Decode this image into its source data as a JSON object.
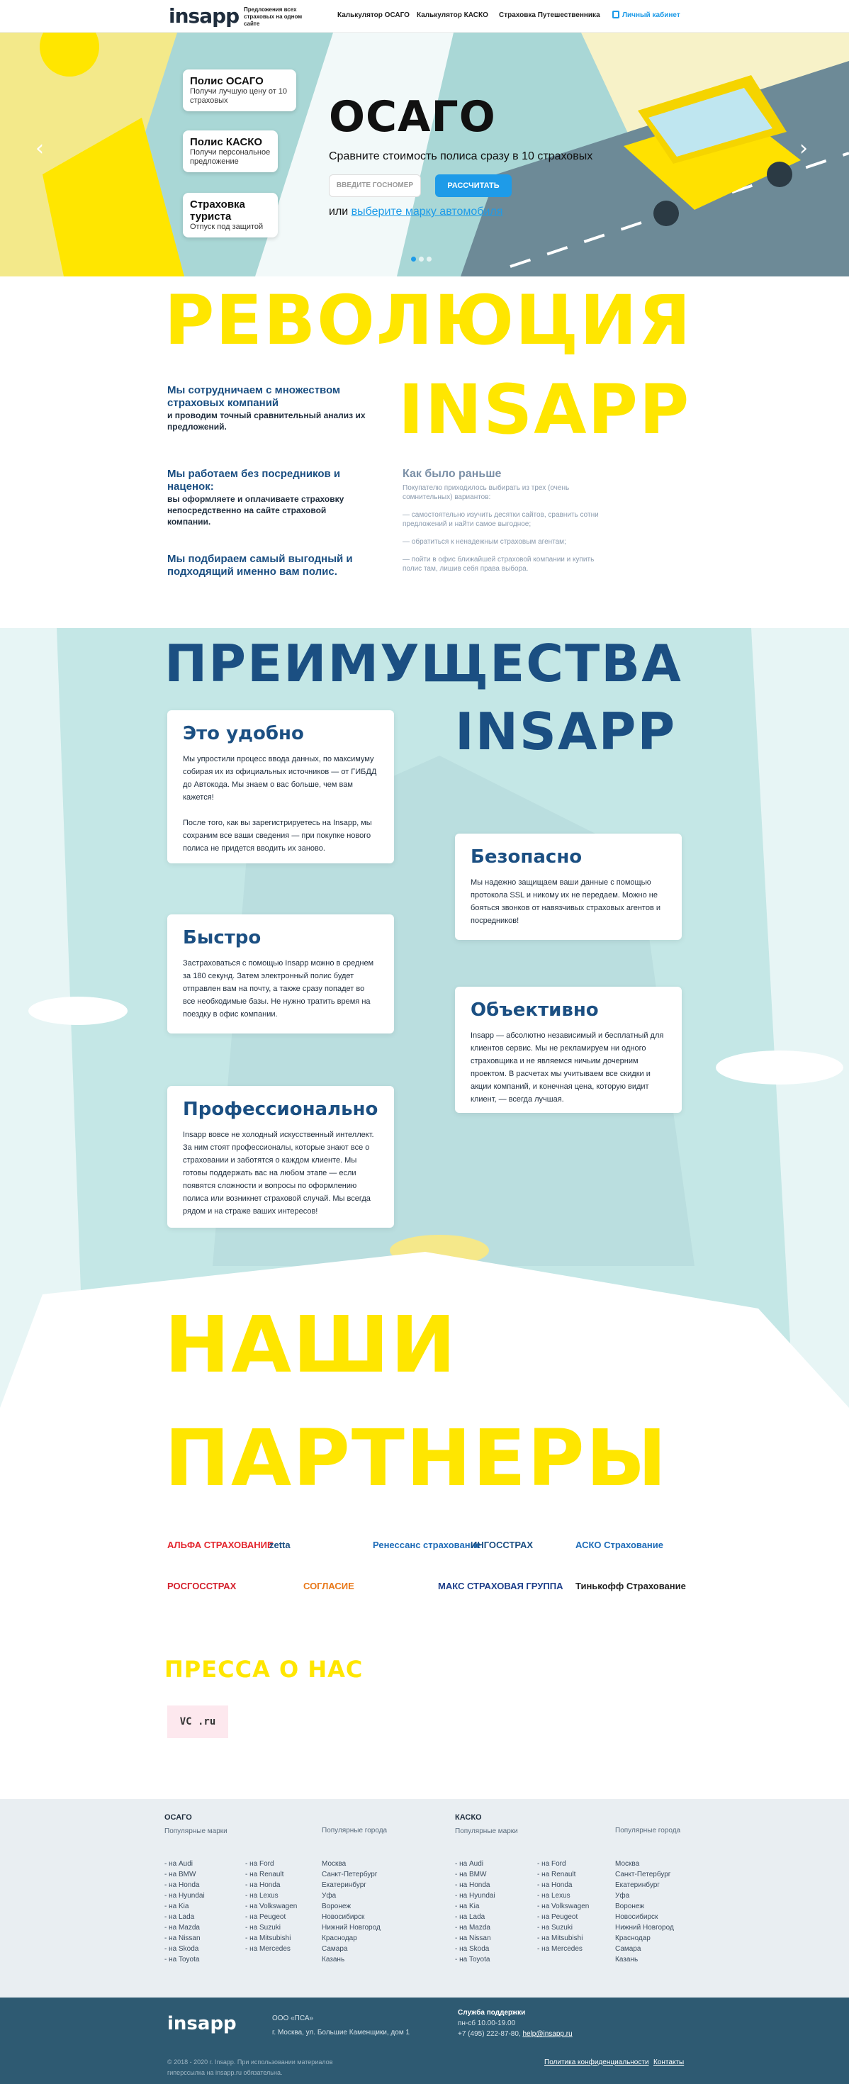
{
  "header": {
    "logo": "insapp",
    "tagline": "Предложения всех страховых на одном сайте",
    "nav": [
      "Калькулятор ОСАГО",
      "Калькулятор КАСКО",
      "Страховка Путешественника"
    ],
    "cabinet": "Личный кабинет"
  },
  "hero": {
    "cards": [
      {
        "title": "Полис ОСАГО",
        "sub": "Получи лучшую цену от 10 страховых"
      },
      {
        "title": "Полис КАСКО",
        "sub": "Получи персональное предложение"
      },
      {
        "title": "Страховка туриста",
        "sub": "Отпуск под защитой"
      }
    ],
    "title": "ОСАГО",
    "subtitle": "Сравните стоимость полиса сразу в 10 страховых",
    "input_placeholder": "ВВЕДИТЕ ГОСНОМЕР",
    "button": "РАССЧИТАТЬ",
    "or": "или",
    "link": "выберите марку автомобиля"
  },
  "revolution": {
    "title1": "РЕВОЛЮЦИЯ",
    "title2": "INSAPP",
    "points": [
      {
        "bold": "Мы сотрудничаем с множеством страховых компаний",
        "text": "и проводим точный сравнительный анализ их предложений."
      },
      {
        "bold": "Мы работаем без посредников и наценок:",
        "text": "вы оформляете и оплачиваете страховку непосредственно на сайте страховой компании."
      },
      {
        "bold": "Мы подбираем самый выгодный и подходящий именно вам полис.",
        "text": ""
      }
    ],
    "was_title": "Как было раньше",
    "was_items": [
      "Покупателю приходилось выбирать из трех (очень сомнительных) вариантов:",
      "— самостоятельно изучить десятки сайтов, сравнить сотни предложений и найти самое выгодное;",
      "— обратиться к ненадежным страховым агентам;",
      "— пойти в офис ближайшей страховой компании и купить полис там, лишив себя права выбора."
    ]
  },
  "advantages": {
    "title1": "ПРЕИМУЩЕСТВА",
    "title2": "INSAPP",
    "cards": [
      {
        "title": "Это удобно",
        "text": "Мы упростили процесс ввода данных, по максимуму собирая их из официальных источников — от ГИБДД до Автокода. Мы знаем о вас больше, чем вам кажется!\n\nПосле того, как вы зарегистрируетесь на Insapp, мы сохраним все ваши сведения — при покупке нового полиса не придется вводить их заново."
      },
      {
        "title": "Безопасно",
        "text": "Мы надежно защищаем ваши данные с помощью протокола SSL и никому их не передаем. Можно не бояться звонков от навязчивых страховых агентов и посредников!"
      },
      {
        "title": "Быстро",
        "text": "Застраховаться с помощью Insapp можно в среднем за 180 секунд. Затем электронный полис будет отправлен вам на почту, а также сразу попадет во все необходимые базы. Не нужно тратить время на поездку в офис компании."
      },
      {
        "title": "Объективно",
        "text": "Insapp — абсолютно независимый и бесплатный для клиентов сервис. Мы не рекламируем ни одного страховщика и не являемся ничьим дочерним проектом. В расчетах мы учитываем все скидки и акции компаний, и конечная цена, которую видит клиент, — всегда лучшая."
      },
      {
        "title": "Профессионально",
        "text": "Insapp вовсе не холодный искусственный интеллект. За ним стоят профессионалы, которые знают все о страховании и заботятся о каждом клиенте. Мы готовы поддержать вас на любом этапе — если появятся сложности и вопросы по оформлению полиса или возникнет страховой случай. Мы всегда рядом и на страже ваших интересов!"
      }
    ]
  },
  "partners": {
    "title1": "НАШИ",
    "title2": "ПАРТНЕРЫ",
    "logos": [
      "АЛЬФА СТРАХОВАНИЕ",
      "zetta",
      "Ренессанс страхование",
      "ИНГОССТРАХ",
      "АСКО Страхование",
      "РОСГОССТРАХ",
      "СОГЛАСИЕ",
      "МАКС СТРАХОВАЯ ГРУППА",
      "Тинькофф Страхование"
    ],
    "colors": [
      "#e3262e",
      "#1b4f82",
      "#1e6cb8",
      "#1b4f82",
      "#1e6cb8",
      "#d4202c",
      "#e8781a",
      "#1e3f8a",
      "#222"
    ]
  },
  "press": {
    "title": "ПРЕССА О НАС",
    "logo": "VC .ru"
  },
  "footer": {
    "osago": {
      "title": "ОСАГО",
      "brands_h": "Популярные марки",
      "cities_h": "Популярные города"
    },
    "kasko": {
      "title": "КАСКО",
      "brands_h": "Популярные марки",
      "cities_h": "Популярные города"
    },
    "brands1": [
      "- на Audi",
      "- на BMW",
      "- на Honda",
      "- на Hyundai",
      "- на Kia",
      "- на Lada",
      "- на Mazda",
      "- на Nissan",
      "- на Skoda",
      "- на Toyota"
    ],
    "brands2": [
      "- на Ford",
      "- на Renault",
      "- на Honda",
      "- на Lexus",
      "- на Volkswagen",
      "- на Peugeot",
      "- на Suzuki",
      "- на Mitsubishi",
      "- на Mercedes"
    ],
    "cities": [
      "Москва",
      "Санкт-Петербург",
      "Екатеринбург",
      "Уфа",
      "Воронеж",
      "Новосибирск",
      "Нижний Новгород",
      "Краснодар",
      "Самара",
      "Казань"
    ],
    "company": "ООО «ПСА»",
    "address": "г. Москва, ул. Большие Каменщики, дом 1",
    "support_h": "Служба поддержки",
    "hours": "пн-сб 10.00-19.00",
    "phone": "+7 (495) 222-87-80,",
    "email": "help@insapp.ru",
    "copyright": "© 2018 - 2020 г. Insapp. При использовании материалов гиперссылка на insapp.ru обязательна.",
    "privacy": "Политика конфиденциальности",
    "contacts": "Контакты",
    "logo": "insapp"
  }
}
